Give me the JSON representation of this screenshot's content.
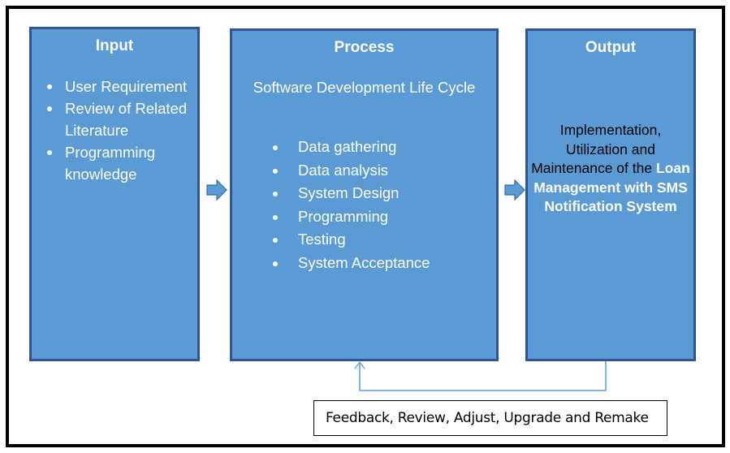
{
  "diagram": {
    "input": {
      "title": "Input",
      "items": [
        "User Requirement",
        "Review of Related Literature",
        "Programming knowledge"
      ]
    },
    "process": {
      "title": "Process",
      "subtitle": "Software Development Life Cycle",
      "items": [
        "Data gathering",
        "Data analysis",
        "System Design",
        "Programming",
        "Testing",
        "System Acceptance"
      ]
    },
    "output": {
      "title": "Output",
      "text_plain": "Implementation, Utilization and Maintenance of the",
      "text_bold": "Loan Management with SMS Notification System"
    },
    "feedback": {
      "label": "Feedback, Review, Adjust, Upgrade and Remake"
    },
    "colors": {
      "box_fill": "#5b9bd5",
      "box_border": "#2f5597",
      "frame": "#000000",
      "feedback_line": "#5b9bd5"
    }
  }
}
